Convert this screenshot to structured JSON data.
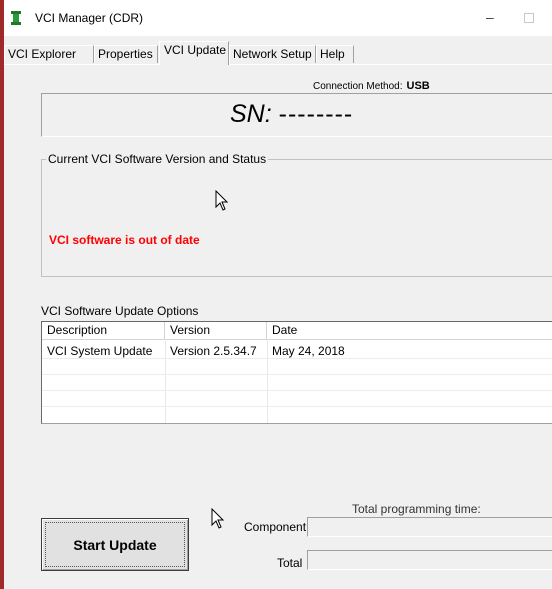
{
  "window": {
    "title": "VCI Manager (CDR)",
    "minimize_glyph": "–"
  },
  "tabs": [
    {
      "label": "VCI Explorer"
    },
    {
      "label": "Properties"
    },
    {
      "label": "VCI Update",
      "active": true
    },
    {
      "label": "Network Setup"
    },
    {
      "label": "Help"
    }
  ],
  "connection": {
    "label": "Connection Method:",
    "value": "USB"
  },
  "serial": {
    "label": "SN:",
    "value": "--------"
  },
  "status_group": {
    "legend": "Current VCI Software Version and Status",
    "message": "VCI software is out of date",
    "message_color": "#ff0000"
  },
  "update_options": {
    "label": "VCI Software Update Options",
    "columns": [
      "Description",
      "Version",
      "Date"
    ],
    "rows": [
      {
        "description": "VCI System Update",
        "version": "Version 2.5.34.7",
        "date": "May 24, 2018"
      }
    ]
  },
  "programming": {
    "total_time_label": "Total programming time:",
    "component_label": "Component",
    "total_label": "Total"
  },
  "buttons": {
    "start_update": "Start Update"
  },
  "icons": {
    "app": "vci-app-icon",
    "cursor": "mouse-pointer-icon"
  }
}
